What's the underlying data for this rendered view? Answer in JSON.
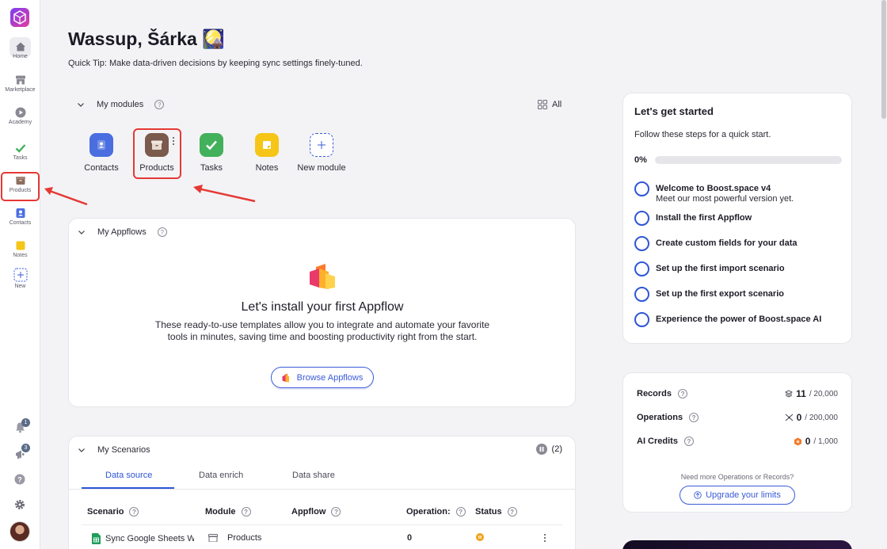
{
  "sidebar": {
    "items": [
      {
        "label": "Home"
      },
      {
        "label": "Marketplace"
      },
      {
        "label": "Academy"
      },
      {
        "label": "Tasks"
      },
      {
        "label": "Products"
      },
      {
        "label": "Contacts"
      },
      {
        "label": "Notes"
      },
      {
        "label": "New"
      }
    ],
    "notifications_count": "1",
    "announcements_count": "3"
  },
  "header": {
    "greeting": "Wassup, Šárka 🎑",
    "tip": "Quick Tip: Make data-driven decisions by keeping sync settings finely-tuned."
  },
  "modules": {
    "title": "My modules",
    "all_label": "All",
    "items": [
      {
        "label": "Contacts"
      },
      {
        "label": "Products"
      },
      {
        "label": "Tasks"
      },
      {
        "label": "Notes"
      },
      {
        "label": "New module"
      }
    ]
  },
  "appflows": {
    "title": "My Appflows",
    "heading": "Let's install your first Appflow",
    "description": "These ready-to-use templates allow you to integrate and automate your favorite tools in minutes, saving time and boosting productivity right from the start.",
    "button": "Browse Appflows"
  },
  "scenarios": {
    "title": "My Scenarios",
    "count": "(2)",
    "tabs": [
      "Data source",
      "Data enrich",
      "Data share"
    ],
    "columns": [
      "Scenario",
      "Module",
      "Appflow",
      "Operation:",
      "Status"
    ],
    "rows": [
      {
        "scenario": "Sync Google Sheets Wi",
        "module": "Products",
        "appflow": "",
        "operations": "0"
      }
    ]
  },
  "get_started": {
    "title": "Let's get started",
    "subtitle": "Follow these steps for a quick start.",
    "progress_label": "0%",
    "progress": 0,
    "steps": [
      {
        "title": "Welcome to Boost.space v4",
        "sub": "Meet our most powerful version yet."
      },
      {
        "title": "Install the first Appflow"
      },
      {
        "title": "Create custom fields for your data"
      },
      {
        "title": "Set up the first import scenario"
      },
      {
        "title": "Set up the first export scenario"
      },
      {
        "title": "Experience the power of Boost.space AI"
      }
    ]
  },
  "limits": {
    "rows": [
      {
        "label": "Records",
        "value": "11",
        "max": "/ 20,000"
      },
      {
        "label": "Operations",
        "value": "0",
        "max": "/ 200,000"
      },
      {
        "label": "AI Credits",
        "value": "0",
        "max": "/ 1,000"
      }
    ],
    "need_more": "Need more Operations or Records?",
    "upgrade_button": "Upgrade your limits"
  },
  "colors": {
    "accent": "#2f56d6",
    "highlight": "#e53935"
  }
}
